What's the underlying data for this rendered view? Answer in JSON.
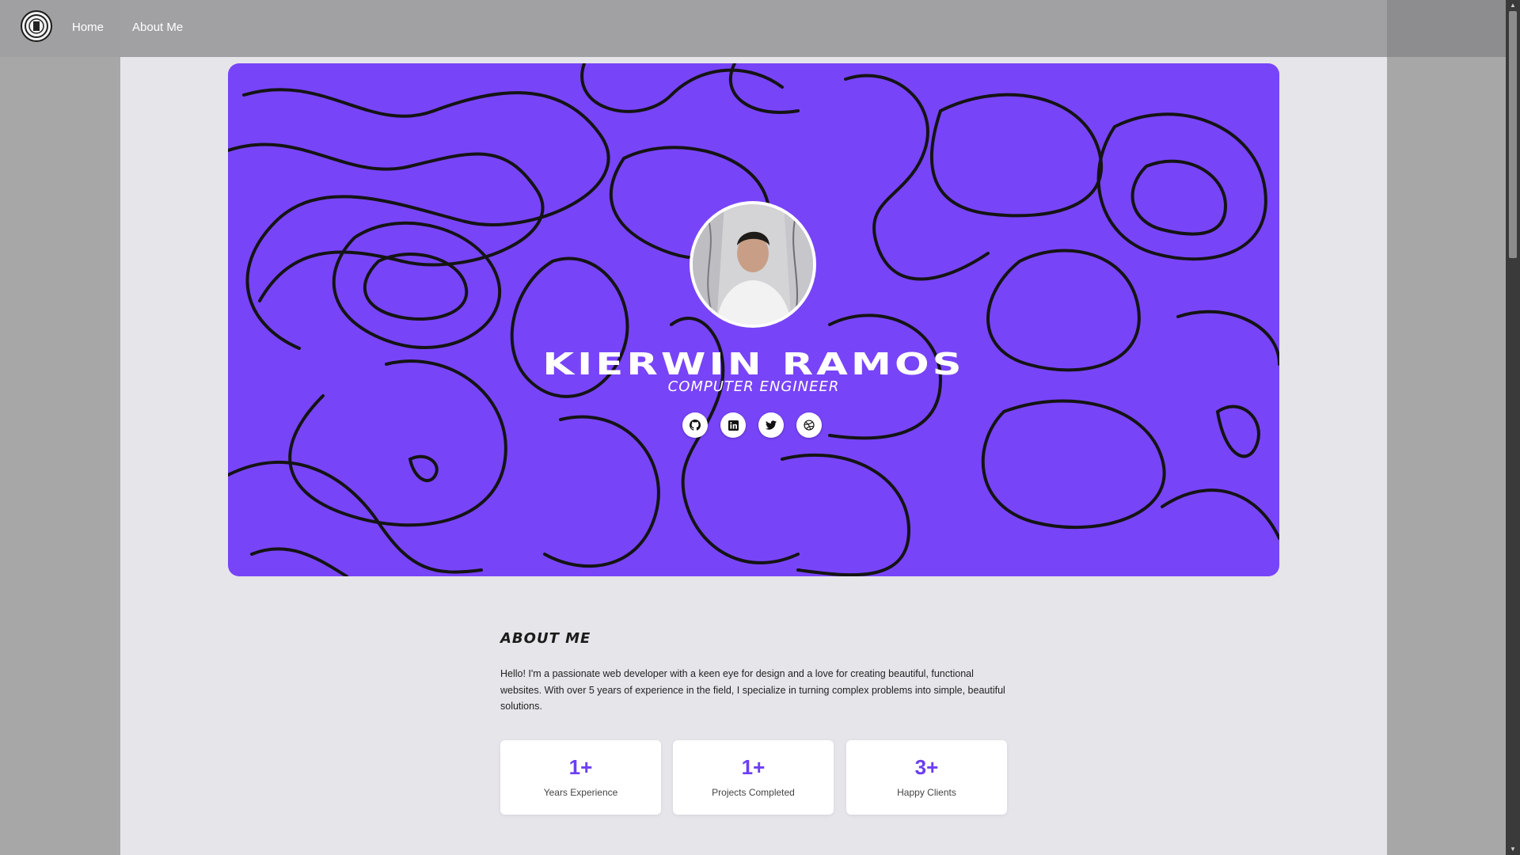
{
  "nav": {
    "logo": "logo-seal",
    "links": [
      "Home",
      "About Me"
    ]
  },
  "hero": {
    "name": "KIERWIN RAMOS",
    "role": "COMPUTER ENGINEER",
    "background_color": "#7844f8",
    "socials": [
      "github-icon",
      "linkedin-icon",
      "twitter-icon",
      "dribbble-icon"
    ]
  },
  "about": {
    "title": "ABOUT ME",
    "text": "Hello! I'm a passionate web developer with a keen eye for design and a love for creating beautiful, functional websites. With over 5 years of experience in the field, I specialize in turning complex problems into simple, beautiful solutions.",
    "stats": [
      {
        "value": "1+",
        "label": "Years Experience"
      },
      {
        "value": "1+",
        "label": "Projects Completed"
      },
      {
        "value": "3+",
        "label": "Happy Clients"
      }
    ],
    "accent_color": "#6c3ef5"
  }
}
